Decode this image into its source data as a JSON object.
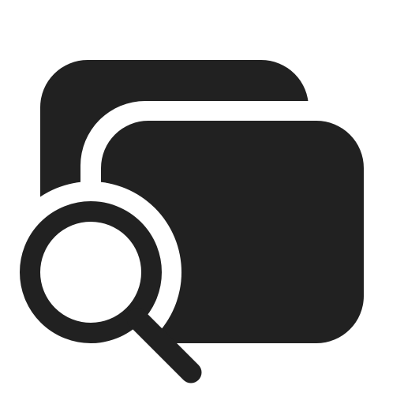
{
  "icon": {
    "name": "multiple-tabs-search-icon",
    "colors": {
      "foreground": "#212121",
      "background": "#ffffff"
    }
  }
}
